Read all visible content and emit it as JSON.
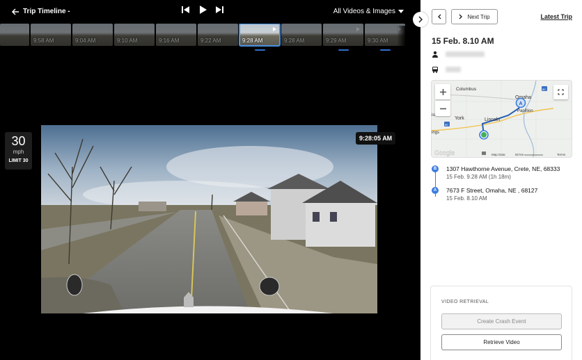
{
  "header": {
    "title": "Trip Timeline -",
    "filter_label": "All Videos & Images"
  },
  "thumbnails": [
    {
      "time": ""
    },
    {
      "time": "9:58 AM"
    },
    {
      "time": "9:04 AM"
    },
    {
      "time": "9:10 AM"
    },
    {
      "time": "9:16 AM"
    },
    {
      "time": "9:22 AM"
    },
    {
      "time": "9:28 AM"
    },
    {
      "time": "9:28 AM"
    },
    {
      "time": "9:29 AM"
    },
    {
      "time": "9:30 AM"
    }
  ],
  "speed": {
    "value": "30",
    "unit": "mph",
    "limit": "LIMIT 30"
  },
  "video": {
    "timestamp": "9:28:05 AM"
  },
  "side": {
    "next_trip_label": "Next Trip",
    "latest_trip_label": "Latest Trip",
    "date": "15 Feb. 8.10 AM",
    "map": {
      "labels": {
        "columbus": "Columbus",
        "omaha": "Omaha",
        "papillion": "Papillion",
        "york": "York",
        "lincoln": "Lincoln",
        "ings": "ings",
        "isl": "isl",
        "google": "Google",
        "map_data": "Map Data",
        "scale": "50 km",
        "terms": "Terms",
        "route_80a": "80",
        "route_80b": "80",
        "marker_a": "A"
      }
    },
    "stops": [
      {
        "badge": "B",
        "address": "1307 Hawthorne Avenue,  Crete,  NE, 68333",
        "time": "15 Feb. 9.28 AM  (1h 18m)"
      },
      {
        "badge": "A",
        "address": "7673 F Street, Omaha, NE , 68127",
        "time": "15 Feb. 8.10 AM"
      }
    ],
    "retrieval": {
      "title": "VIDEO RETRIEVAL",
      "crash_label": "Create Crash Event",
      "retrieve_label": "Retrieve Video"
    }
  }
}
